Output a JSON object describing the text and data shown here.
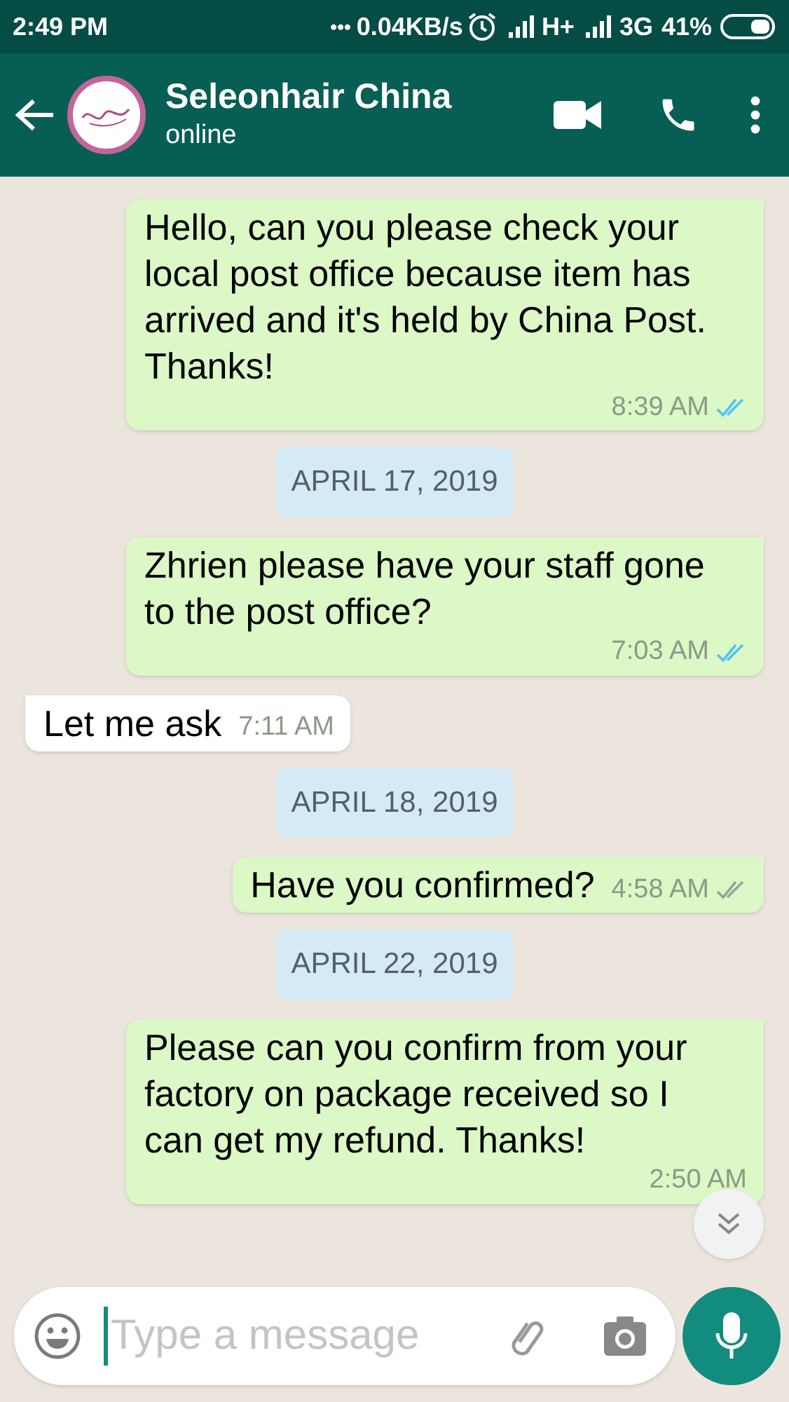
{
  "status_bar": {
    "time": "2:49 PM",
    "dots": "•••",
    "speed": "0.04KB/s",
    "network_1": "H+",
    "network_2": "3G",
    "battery": "41%"
  },
  "header": {
    "title": "Seleonhair China",
    "subtitle": "online"
  },
  "messages": [
    {
      "kind": "outgoing",
      "text": "Hello, can you please check your local post office because item has arrived and it's held by China Post. Thanks!",
      "time": "8:39 AM",
      "read": true
    },
    {
      "kind": "date",
      "text": "APRIL 17, 2019"
    },
    {
      "kind": "outgoing",
      "text": "Zhrien please have your staff gone to the post office?",
      "time": "7:03 AM",
      "read": true
    },
    {
      "kind": "incoming",
      "text": "Let me ask",
      "time": "7:11 AM"
    },
    {
      "kind": "date",
      "text": "APRIL 18, 2019"
    },
    {
      "kind": "outgoing",
      "text": "Have you confirmed?",
      "time": "4:58 AM",
      "read": false
    },
    {
      "kind": "date",
      "text": "APRIL 22, 2019"
    },
    {
      "kind": "outgoing",
      "text": "Please can you confirm from your factory on package received so I can get my refund. Thanks!",
      "time": "2:50 AM"
    }
  ],
  "composer": {
    "placeholder": "Type a message"
  }
}
